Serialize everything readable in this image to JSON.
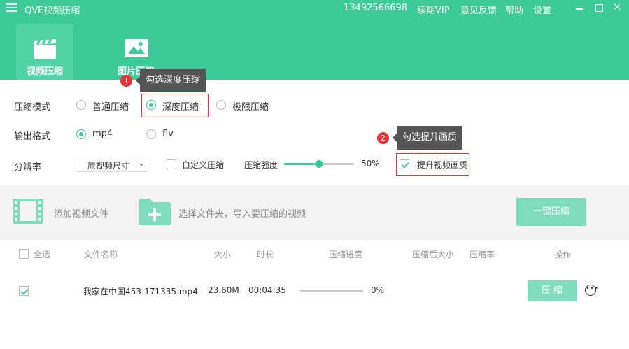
{
  "titlebar": {
    "app_title": "QVE视频压缩",
    "phone": "13492566698",
    "renew": "续期VIP",
    "feedback": "意见反馈",
    "help": "帮助",
    "settings": "设置",
    "close_glyph": "×"
  },
  "tabs": [
    {
      "label": "视频压缩",
      "icon": "film-clapper-icon",
      "active": true
    },
    {
      "label": "图片压缩",
      "icon": "image-icon",
      "active": false
    }
  ],
  "compress_mode": {
    "label": "压缩模式",
    "options": [
      "普通压缩",
      "深度压缩",
      "极限压缩"
    ],
    "selected": "深度压缩"
  },
  "output_format": {
    "label": "输出格式",
    "options": [
      "mp4",
      "flv"
    ],
    "selected": "mp4"
  },
  "resolution": {
    "label": "分辨率",
    "value": "原视频尺寸",
    "custom_label": "自定义压缩",
    "custom_checked": false,
    "strength_label": "压缩强度",
    "strength_value": "50%",
    "strength": 50,
    "enhance_label": "提升视频画质",
    "enhance_checked": true
  },
  "tips": [
    {
      "badge": "1",
      "text": "勾选深度压缩"
    },
    {
      "badge": "2",
      "text": "勾选提升画质"
    }
  ],
  "filebar": {
    "add_video": "添加视频文件",
    "select_folder": "选择文件夹，导入要压缩的视频",
    "compress_all": "一键压缩"
  },
  "table": {
    "headers": {
      "select_all": "全选",
      "name": "文件名称",
      "size": "大小",
      "duration": "时长",
      "progress": "压缩进度",
      "after_size": "压缩后大小",
      "ratio": "压缩率",
      "actions": "操作"
    },
    "rows": [
      {
        "checked": true,
        "name": "我家在中国453-171335.mp4",
        "size": "23.60M",
        "duration": "00:04:35",
        "progress_pct": 0,
        "progress_text": "0%",
        "compress_btn": "压 缩",
        "more_glyph": "•••"
      }
    ]
  },
  "colors": {
    "accent": "#3ccb97",
    "header_bg": "#3ccb97",
    "badge": "#e8333c",
    "highlight_box": "#ee3333"
  }
}
